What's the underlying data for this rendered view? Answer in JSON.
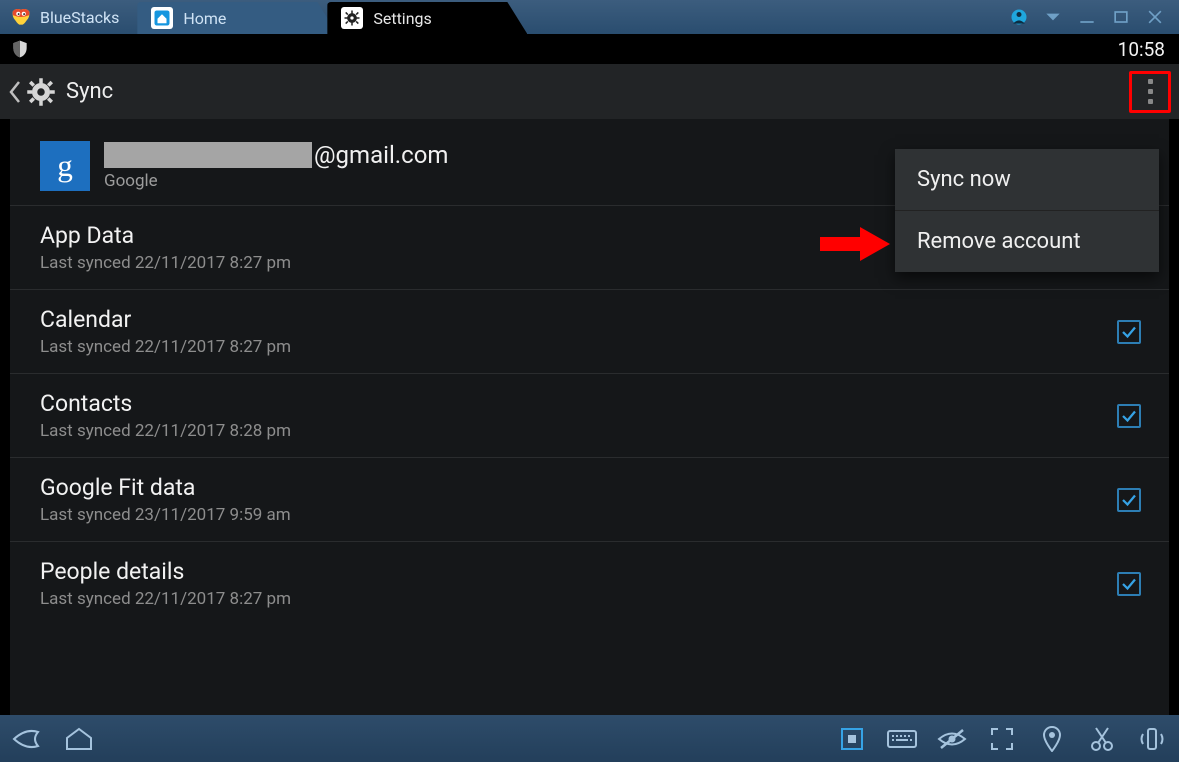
{
  "titlebar": {
    "brand": "BlueStacks",
    "tabs": [
      {
        "label": "Home",
        "icon": "home-app-icon",
        "active": false
      },
      {
        "label": "Settings",
        "icon": "settings-app-icon",
        "active": true
      }
    ]
  },
  "statusbar": {
    "time": "10:58"
  },
  "actionbar": {
    "title": "Sync"
  },
  "account": {
    "email_suffix": "@gmail.com",
    "provider": "Google",
    "badge_letter": "g"
  },
  "sync_items": [
    {
      "title": "App Data",
      "sub": "Last synced 22/11/2017 8:27 pm",
      "checked": true
    },
    {
      "title": "Calendar",
      "sub": "Last synced 22/11/2017 8:27 pm",
      "checked": true
    },
    {
      "title": "Contacts",
      "sub": "Last synced 22/11/2017 8:28 pm",
      "checked": true
    },
    {
      "title": "Google Fit data",
      "sub": "Last synced 23/11/2017 9:59 am",
      "checked": true
    },
    {
      "title": "People details",
      "sub": "Last synced 22/11/2017 8:27 pm",
      "checked": true
    }
  ],
  "popup_menu": {
    "items": [
      {
        "label": "Sync now"
      },
      {
        "label": "Remove account"
      }
    ]
  },
  "colors": {
    "google_blue": "#1d6fbf",
    "check_blue": "#36a3e6",
    "highlight_red": "#ff0000"
  }
}
